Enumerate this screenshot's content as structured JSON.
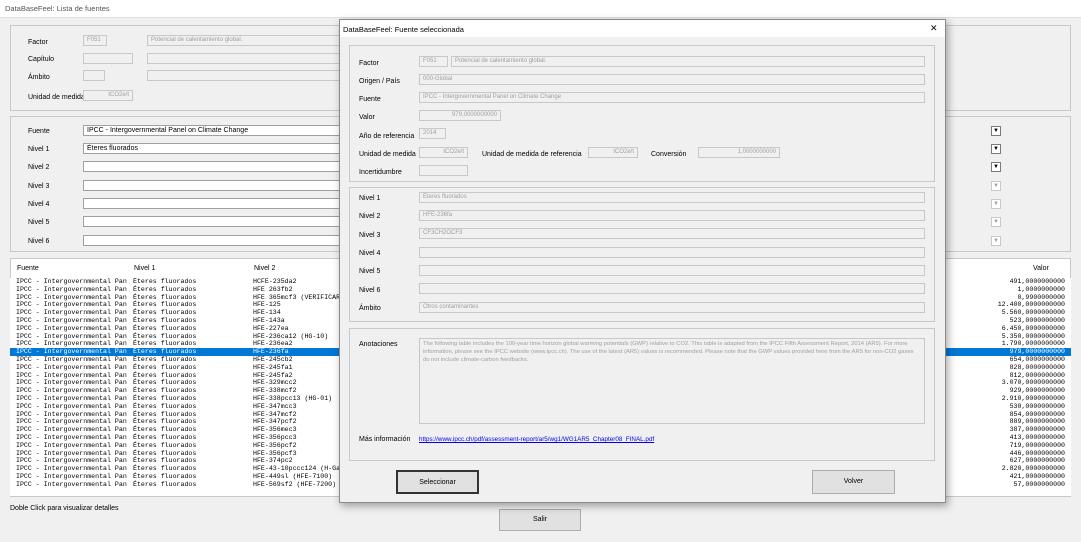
{
  "window": {
    "title": "DataBaseFeel: Lista de fuentes"
  },
  "top": {
    "factor": {
      "label": "Factor",
      "code": "F051",
      "value": "Potencial de calentamiento global."
    },
    "capitulo": {
      "label": "Capítulo"
    },
    "ambito": {
      "label": "Ámbito"
    },
    "unidad": {
      "label": "Unidad de medida",
      "value": "tCO2e/t"
    }
  },
  "filters": {
    "fuente": {
      "label": "Fuente",
      "value": "IPCC - Intergovernmental Panel on Climate Change"
    },
    "nivel1": {
      "label": "Nivel 1",
      "value": "Éteres fluorados"
    },
    "nivel2": {
      "label": "Nivel 2"
    },
    "nivel3": {
      "label": "Nivel 3"
    },
    "nivel4": {
      "label": "Nivel 4"
    },
    "nivel5": {
      "label": "Nivel 5"
    },
    "nivel6": {
      "label": "Nivel 6"
    }
  },
  "list": {
    "headers": {
      "fuente": "Fuente",
      "nivel1": "Nivel 1",
      "nivel2": "Nivel 2",
      "valor": "Valor"
    },
    "rows": [
      [
        "IPCC - Intergovernmental Pan",
        "Éteres fluorados",
        "HCFE-235da2",
        "491,0000000000"
      ],
      [
        "IPCC - Intergovernmental Pan",
        "Éteres fluorados",
        "HFE 263fb2",
        "1,0000000000"
      ],
      [
        "IPCC - Intergovernmental Pan",
        "Éteres fluorados",
        "HFE 365mcf3 (VERIFICAR",
        "0,9900000000"
      ],
      [
        "IPCC - Intergovernmental Pan",
        "Éteres fluorados",
        "HFE-125",
        "12.400,0000000000"
      ],
      [
        "IPCC - Intergovernmental Pan",
        "Éteres fluorados",
        "HFE-134",
        "5.560,0000000000"
      ],
      [
        "IPCC - Intergovernmental Pan",
        "Éteres fluorados",
        "HFE-143a",
        "523,0000000000"
      ],
      [
        "IPCC - Intergovernmental Pan",
        "Éteres fluorados",
        "HFE-227ea",
        "6.450,0000000000"
      ],
      [
        "IPCC - Intergovernmental Pan",
        "Éteres fluorados",
        "HFE-236ca12 (HG-10)",
        "5.350,0000000000"
      ],
      [
        "IPCC - Intergovernmental Pan",
        "Éteres fluorados",
        "HFE-236ea2",
        "1.790,0000000000"
      ],
      [
        "IPCC - Intergovernmental Pan",
        "Éteres fluorados",
        "HFE-236fa",
        "979,0000000000"
      ],
      [
        "IPCC - Intergovernmental Pan",
        "Éteres fluorados",
        "HFE-245cb2",
        "654,0000000000"
      ],
      [
        "IPCC - Intergovernmental Pan",
        "Éteres fluorados",
        "HFE-245fa1",
        "828,0000000000"
      ],
      [
        "IPCC - Intergovernmental Pan",
        "Éteres fluorados",
        "HFE-245fa2",
        "812,0000000000"
      ],
      [
        "IPCC - Intergovernmental Pan",
        "Éteres fluorados",
        "HFE-329mcc2",
        "3.070,0000000000"
      ],
      [
        "IPCC - Intergovernmental Pan",
        "Éteres fluorados",
        "HFE-338mcf2",
        "929,0000000000"
      ],
      [
        "IPCC - Intergovernmental Pan",
        "Éteres fluorados",
        "HFE-338pcc13 (HG-01)",
        "2.910,0000000000"
      ],
      [
        "IPCC - Intergovernmental Pan",
        "Éteres fluorados",
        "HFE-347mcc3",
        "530,0000000000"
      ],
      [
        "IPCC - Intergovernmental Pan",
        "Éteres fluorados",
        "HFE-347mcf2",
        "854,0000000000"
      ],
      [
        "IPCC - Intergovernmental Pan",
        "Éteres fluorados",
        "HFE-347pcf2",
        "889,0000000000"
      ],
      [
        "IPCC - Intergovernmental Pan",
        "Éteres fluorados",
        "HFE-356mec3",
        "387,0000000000"
      ],
      [
        "IPCC - Intergovernmental Pan",
        "Éteres fluorados",
        "HFE-356pcc3",
        "413,0000000000"
      ],
      [
        "IPCC - Intergovernmental Pan",
        "Éteres fluorados",
        "HFE-356pcf2",
        "719,0000000000"
      ],
      [
        "IPCC - Intergovernmental Pan",
        "Éteres fluorados",
        "HFE-356pcf3",
        "446,0000000000"
      ],
      [
        "IPCC - Intergovernmental Pan",
        "Éteres fluorados",
        "HFE-374pc2",
        "627,0000000000"
      ],
      [
        "IPCC - Intergovernmental Pan",
        "Éteres fluorados",
        "HFE-43-10pccc124 (H-Ga",
        "2.820,0000000000"
      ],
      [
        "IPCC - Intergovernmental Pan",
        "Éteres fluorados",
        "HFE-449sl (HFE-7100)",
        "421,0000000000"
      ],
      [
        "IPCC - Intergovernmental Pan",
        "Éteres fluorados",
        "HFE-569sf2 (HFE-7200)",
        "57,0000000000"
      ]
    ],
    "selected_index": 9
  },
  "footer": {
    "hint": "Doble Click para visualizar detalles",
    "salir": "Salir"
  },
  "dialog": {
    "title": "DataBaseFeel: Fuente seleccionada",
    "close": "✕",
    "factor": {
      "label": "Factor",
      "code": "F051",
      "value": "Potencial de calentamiento global."
    },
    "origen": {
      "label": "Origen / País",
      "value": "000-Global"
    },
    "fuente": {
      "label": "Fuente",
      "value": "IPCC - Intergovernmental Panel on Climate Change"
    },
    "valor": {
      "label": "Valor",
      "value": "979,0000000000"
    },
    "anio": {
      "label": "Año de referencia",
      "value": "2014"
    },
    "unidad": {
      "label": "Unidad de medida",
      "value": "tCO2e/t"
    },
    "unidad_ref": {
      "label": "Unidad de medida de referencia",
      "value": "tCO2e/t"
    },
    "conversion": {
      "label": "Conversión",
      "value": "1,0000000000"
    },
    "incertidumbre": {
      "label": "Incertidumbre",
      "value": ""
    },
    "nivel1": {
      "label": "Nivel 1",
      "value": "Éteres fluorados"
    },
    "nivel2": {
      "label": "Nivel 2",
      "value": "HFE-236fa"
    },
    "nivel3": {
      "label": "Nivel 3",
      "value": "CF3CH2OCF3"
    },
    "nivel4": {
      "label": "Nivel 4",
      "value": ""
    },
    "nivel5": {
      "label": "Nivel 5",
      "value": ""
    },
    "nivel6": {
      "label": "Nivel 6",
      "value": ""
    },
    "ambito": {
      "label": "Ámbito",
      "value": "Otros contaminantes"
    },
    "anotaciones": {
      "label": "Anotaciones",
      "value": "The following table includes the 100-year time horizon global warming potentials (GWP) relative to CO2. This table is adapted from the IPCC Fifth Assessment Report, 2014 (AR5). For more information, please see the IPCC website (www.ipcc.ch). The use of the latest (AR5) values is recommended. Please note that the GWP values provided here from the AR5 for non-CO2 gases do not include climate-carbon feedbacks."
    },
    "mas_info": {
      "label": "Más información",
      "link": "https://www.ipcc.ch/pdf/assessment-report/ar5/wg1/WG1AR5_Chapter08_FINAL.pdf"
    },
    "seleccionar": "Seleccionar",
    "volver": "Volver"
  },
  "icons": {
    "dropdown": "chevron-down-icon",
    "close": "close-icon"
  }
}
